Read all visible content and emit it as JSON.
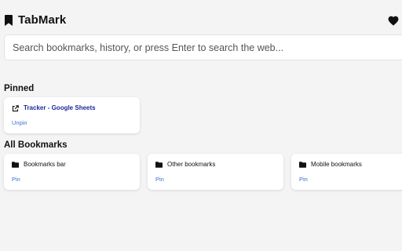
{
  "app": {
    "title": "TabMark"
  },
  "search": {
    "placeholder": "Search bookmarks, history, or press Enter to search the web..."
  },
  "pinned": {
    "heading": "Pinned",
    "items": [
      {
        "name": "Tracker - Google Sheets",
        "action": "Unpin",
        "icon": "external-link-icon"
      }
    ]
  },
  "all_bookmarks": {
    "heading": "All Bookmarks",
    "items": [
      {
        "name": "Bookmarks bar",
        "action": "Pin",
        "icon": "folder-icon"
      },
      {
        "name": "Other bookmarks",
        "action": "Pin",
        "icon": "folder-icon"
      },
      {
        "name": "Mobile bookmarks",
        "action": "Pin",
        "icon": "folder-icon"
      }
    ]
  },
  "icons": {
    "brand": "bookmark-icon",
    "favorite": "heart-icon"
  },
  "colors": {
    "background": "#f4f4f4",
    "link": "#1a2a9c",
    "action": "#3b6fd6",
    "card": "#ffffff"
  }
}
